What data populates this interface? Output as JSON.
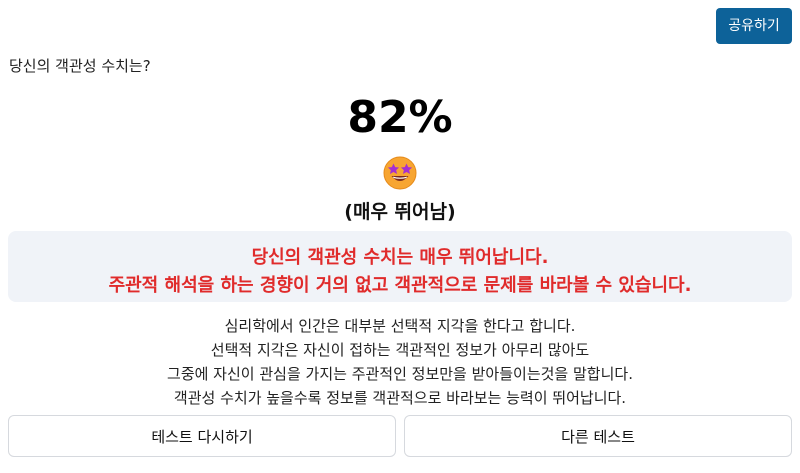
{
  "header": {
    "share_label": "공유하기"
  },
  "result": {
    "question": "당신의 객관성 수치는?",
    "score": "82%",
    "emoji": "star-struck-emoji",
    "grade": "(매우 뛰어남)"
  },
  "highlight": {
    "line1": "당신의 객관성 수치는 매우 뛰어납니다.",
    "line2": "주관적 해석을 하는 경향이 거의 없고 객관적으로 문제를 바라볼 수 있습니다."
  },
  "description": {
    "line1": "심리학에서 인간은 대부분 선택적 지각을 한다고 합니다.",
    "line2": "선택적 지각은 자신이 접하는 객관적인 정보가 아무리 많아도",
    "line3": "그중에 자신이 관심을 가지는 주관적인 정보만을 받아들이는것을 말합니다.",
    "line4": "객관성 수치가 높을수록 정보를 객관적으로 바라보는 능력이 뛰어납니다."
  },
  "actions": {
    "retry_label": "테스트 다시하기",
    "other_label": "다른 테스트"
  },
  "colors": {
    "share_button_bg": "#0d6299",
    "highlight_text": "#e02b2b",
    "highlight_bg": "#f0f3f8"
  }
}
